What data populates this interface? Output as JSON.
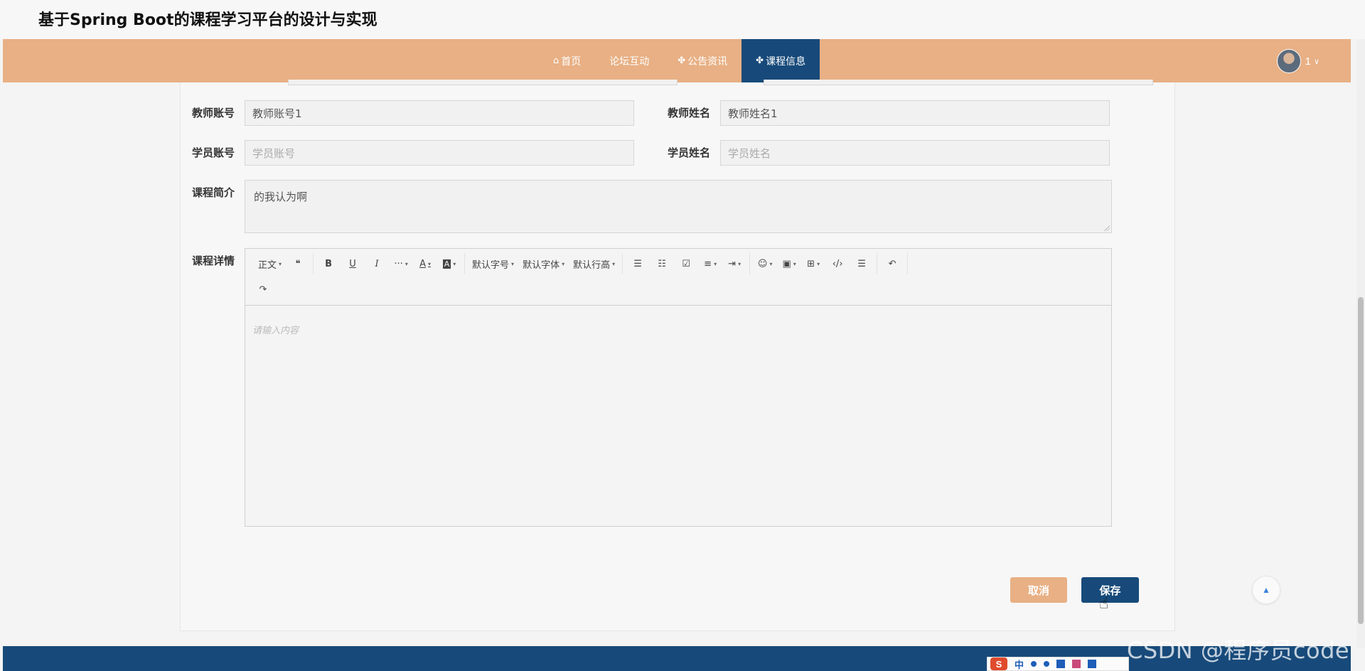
{
  "site": {
    "title": "基于Spring Boot的课程学习平台的设计与实现"
  },
  "nav": {
    "items": [
      {
        "label": "首页",
        "icon": "home-icon",
        "glyph": "⌂"
      },
      {
        "label": "论坛互动",
        "icon": "",
        "glyph": ""
      },
      {
        "label": "公告资讯",
        "icon": "grid-icon",
        "glyph": "✤"
      },
      {
        "label": "课程信息",
        "icon": "grid-icon",
        "glyph": "✤",
        "active": true
      }
    ],
    "user_name": "1",
    "caret": "∨"
  },
  "form": {
    "teacher_account": {
      "label": "教师账号",
      "value": "教师账号1"
    },
    "teacher_name": {
      "label": "教师姓名",
      "value": "教师姓名1"
    },
    "student_account": {
      "label": "学员账号",
      "placeholder": "学员账号"
    },
    "student_name": {
      "label": "学员姓名",
      "placeholder": "学员姓名"
    },
    "course_intro": {
      "label": "课程简介",
      "value": "的我认为啊"
    },
    "course_detail": {
      "label": "课程详情",
      "placeholder": "请输入内容"
    }
  },
  "editor_toolbar": {
    "paragraph": "正文",
    "quote": "❝",
    "bold": "B",
    "underline": "U",
    "italic": "I",
    "more": "···",
    "font_color": "A",
    "bg_color": "A",
    "font_size": "默认字号",
    "font_family": "默认字体",
    "line_height": "默认行高",
    "bullet_list": "☰",
    "numbered_list": "☷",
    "todo": "☑",
    "align": "≡",
    "indent": "⇥",
    "emoji": "☺",
    "image": "▣",
    "table": "⊞",
    "code": "‹/›",
    "divider": "☰",
    "undo": "↶",
    "redo": "↷",
    "dropdown_glyph": "▾"
  },
  "buttons": {
    "cancel": "取消",
    "save": "保存"
  },
  "back_to_top": "▲",
  "watermark": "CSDN @程序员code",
  "ime": {
    "logo": "S",
    "lang": "中"
  },
  "colors": {
    "nav": "#e8b084",
    "accent": "#174a7a",
    "footer": "#174a7a"
  }
}
